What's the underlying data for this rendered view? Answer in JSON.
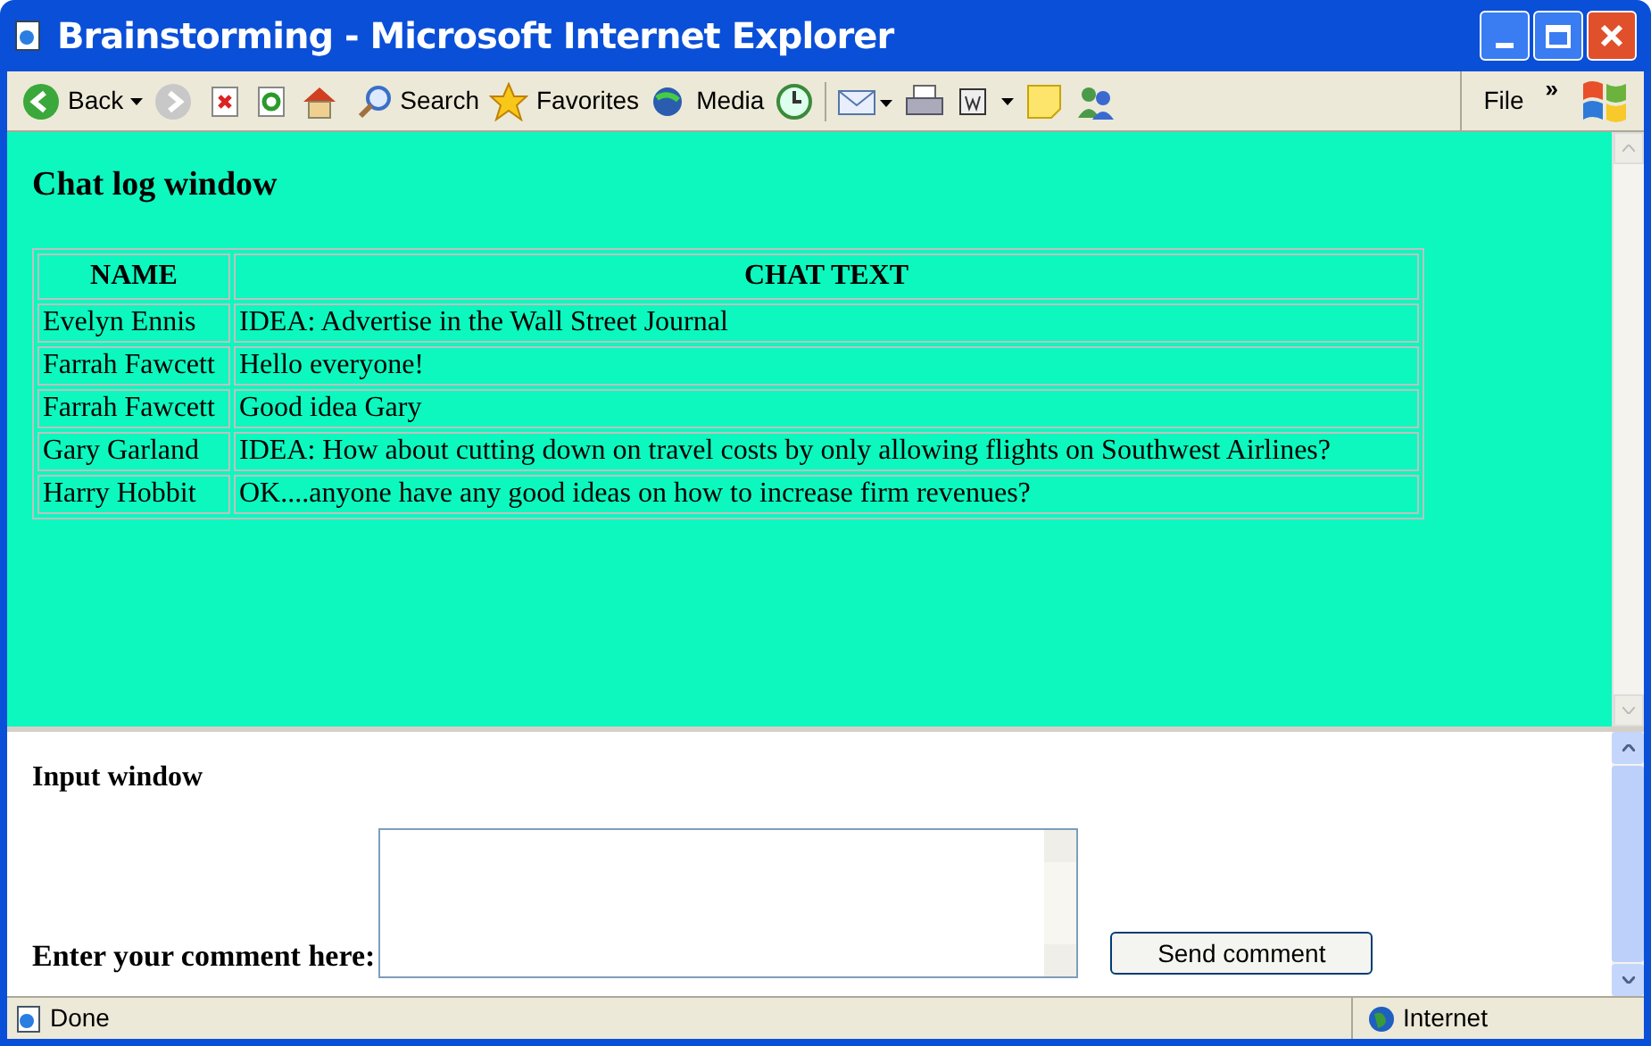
{
  "window": {
    "title": "Brainstorming - Microsoft Internet Explorer"
  },
  "toolbar": {
    "back": "Back",
    "search": "Search",
    "favorites": "Favorites",
    "media": "Media",
    "menu": "File",
    "overflow": "»"
  },
  "chat_log": {
    "heading": "Chat log window",
    "columns": [
      "NAME",
      "CHAT TEXT"
    ],
    "rows": [
      [
        "Evelyn Ennis",
        "IDEA: Advertise in the Wall Street Journal"
      ],
      [
        "Farrah Fawcett",
        "Hello everyone!"
      ],
      [
        "Farrah Fawcett",
        "Good idea Gary"
      ],
      [
        "Gary Garland",
        "IDEA: How about cutting down on travel costs by only allowing flights on Southwest Airlines?"
      ],
      [
        "Harry Hobbit",
        "OK....anyone have any good ideas on how to increase firm revenues?"
      ]
    ]
  },
  "input": {
    "heading": "Input window",
    "label": "Enter your comment here:",
    "button": "Send comment"
  },
  "status_bar": {
    "text": "Done",
    "zone": "Internet"
  }
}
